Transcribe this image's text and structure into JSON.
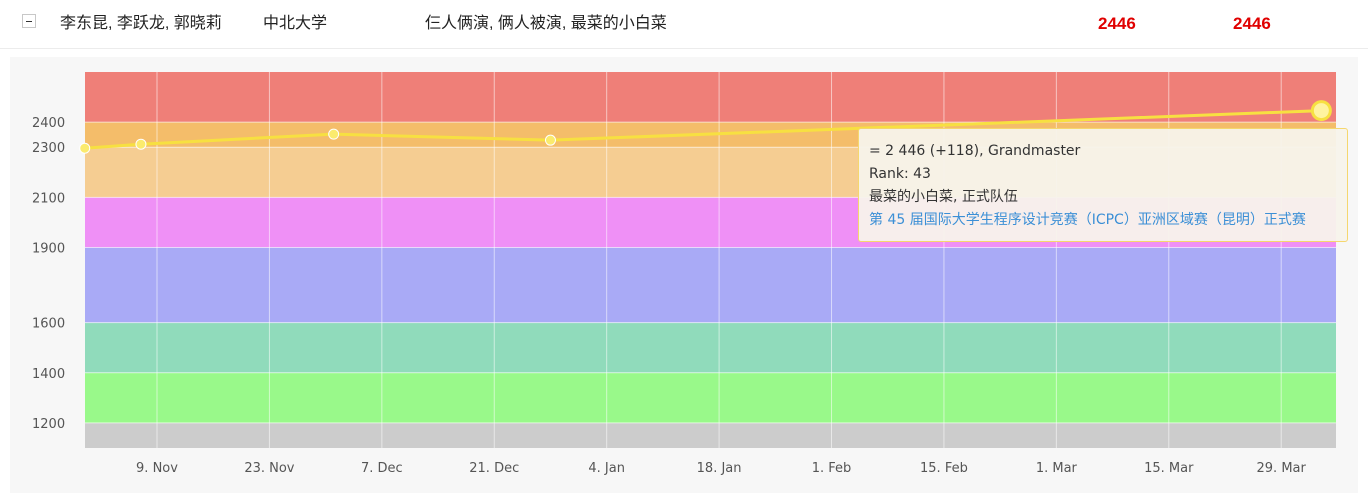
{
  "row": {
    "members": "李东昆, 李跃龙, 郭晓莉",
    "school": "中北大学",
    "team": "仨人俩演, 俩人被演, 最菜的小白菜",
    "rating_current": "2446",
    "rating_max": "2446"
  },
  "tooltip": {
    "rating_line": "= 2 446 (+118), Grandmaster",
    "rank_line": "Rank: 43",
    "team_line": "最菜的小白菜, 正式队伍",
    "contest_link": "第 45 届国际大学生程序设计竞赛（ICPC）亚洲区域赛（昆明）正式赛"
  },
  "chart_data": {
    "type": "line",
    "title": "",
    "xlabel": "",
    "ylabel": "",
    "ylim": [
      1100,
      2600
    ],
    "x_tick_labels": [
      "9. Nov",
      "23. Nov",
      "7. Dec",
      "21. Dec",
      "4. Jan",
      "18. Jan",
      "1. Feb",
      "15. Feb",
      "1. Mar",
      "15. Mar",
      "29. Mar"
    ],
    "y_tick_labels": [
      1200,
      1400,
      1600,
      1900,
      2100,
      2300,
      2400
    ],
    "bands": [
      {
        "from": 1100,
        "to": 1200,
        "color": "#cccccc"
      },
      {
        "from": 1200,
        "to": 1400,
        "color": "#99f98a"
      },
      {
        "from": 1400,
        "to": 1600,
        "color": "#90dbbb"
      },
      {
        "from": 1600,
        "to": 1900,
        "color": "#a9aaf6"
      },
      {
        "from": 1900,
        "to": 2100,
        "color": "#ef90f6"
      },
      {
        "from": 2100,
        "to": 2300,
        "color": "#f5cd92"
      },
      {
        "from": 2300,
        "to": 2400,
        "color": "#f4bd6a"
      },
      {
        "from": 2400,
        "to": 2600,
        "color": "#ef7f78"
      }
    ],
    "series": [
      {
        "color": "#f7e041",
        "points": [
          {
            "x": "2020-10-31",
            "y": 2296
          },
          {
            "x": "2020-11-07",
            "y": 2312
          },
          {
            "x": "2020-12-01",
            "y": 2352
          },
          {
            "x": "2020-12-28",
            "y": 2328
          },
          {
            "x": "2021-04-03",
            "y": 2446
          }
        ]
      }
    ],
    "highlighted_point": {
      "x": "2021-04-03",
      "y": 2446
    },
    "grid": true
  }
}
